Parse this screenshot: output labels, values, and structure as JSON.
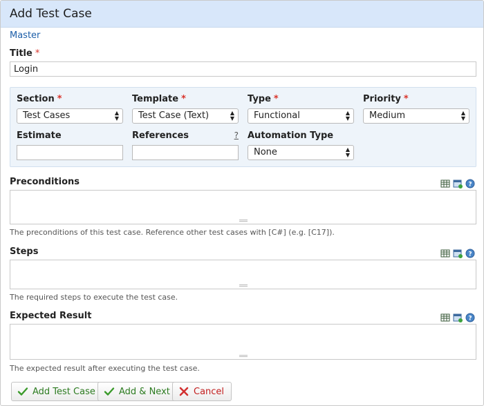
{
  "header": {
    "title": "Add Test Case"
  },
  "breadcrumb": {
    "label": "Master"
  },
  "title_field": {
    "label": "Title",
    "required_mark": "*",
    "value": "Login"
  },
  "panel": {
    "section": {
      "label": "Section",
      "required_mark": "*",
      "value": "Test Cases"
    },
    "template": {
      "label": "Template",
      "required_mark": "*",
      "value": "Test Case (Text)"
    },
    "type": {
      "label": "Type",
      "required_mark": "*",
      "value": "Functional"
    },
    "priority": {
      "label": "Priority",
      "required_mark": "*",
      "value": "Medium"
    },
    "estimate": {
      "label": "Estimate",
      "value": ""
    },
    "references": {
      "label": "References",
      "help": "?",
      "value": ""
    },
    "automation_type": {
      "label": "Automation Type",
      "value": "None"
    }
  },
  "preconditions": {
    "label": "Preconditions",
    "hint": "The preconditions of this test case. Reference other test cases with [C#] (e.g. [C17])."
  },
  "steps": {
    "label": "Steps",
    "hint": "The required steps to execute the test case."
  },
  "expected_result": {
    "label": "Expected Result",
    "hint": "The expected result after executing the test case."
  },
  "buttons": {
    "add": "Add Test Case",
    "add_next": "Add & Next",
    "cancel": "Cancel"
  },
  "icons": {
    "table": "table-icon",
    "image": "image-icon",
    "help": "help-icon",
    "check": "checkmark-icon",
    "cancel": "x-icon"
  },
  "colors": {
    "header_bg": "#d8e7fa",
    "panel_bg": "#eef4fa",
    "link": "#1c5ea8",
    "required": "#d9342b",
    "success": "#2c7b20",
    "danger": "#c21e1e"
  }
}
